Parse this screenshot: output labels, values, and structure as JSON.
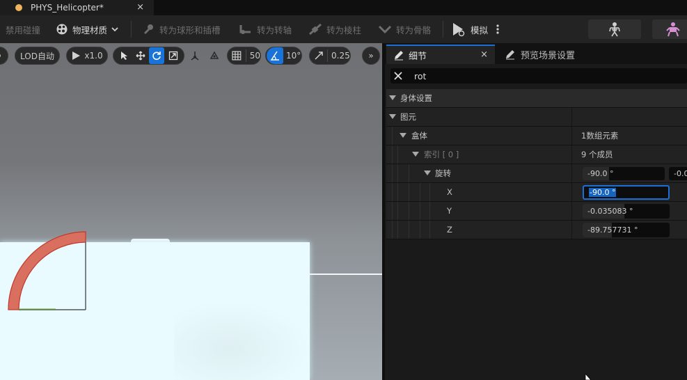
{
  "window": {
    "tab_title": "PHYS_Helicopter*",
    "tab_close": "×"
  },
  "toolbar": {
    "disable_collision": "禁用碰撞",
    "physical_material": "物理材质",
    "to_sphyl": "转为球形和插槽",
    "to_shaft": "转为转轴",
    "to_prism": "转为棱柱",
    "to_skeleton": "转为骨骼",
    "simulate": "模拟"
  },
  "viewport": {
    "lod": "LOD自动",
    "play_speed": "x1.0",
    "grid_snap": "50",
    "angle_snap": "10°",
    "scale_snap": "0.25",
    "more": "»"
  },
  "details_panel": {
    "tab_details": "细节",
    "tab_preview": "预览场景设置",
    "tab_close": "×",
    "search_value": "rot",
    "rows": {
      "body_setup": "身体设置",
      "primitives": "图元",
      "box": "盒体",
      "box_value": "1数组元素",
      "index": "索引 [ 0 ]",
      "index_value": "9 个成员",
      "rotation": "旋转",
      "rotation_summary_1": "-90.0 °",
      "rotation_summary_2": "-0.0",
      "x_label": "X",
      "x_value": "-90.0 °",
      "y_label": "Y",
      "y_value": "-0.035083 °",
      "z_label": "Z",
      "z_value": "-89.757731 °"
    }
  },
  "colors": {
    "accent": "#1c6fd4",
    "gizmo_red": "#d9705f",
    "hull": "#e9fbfe"
  }
}
